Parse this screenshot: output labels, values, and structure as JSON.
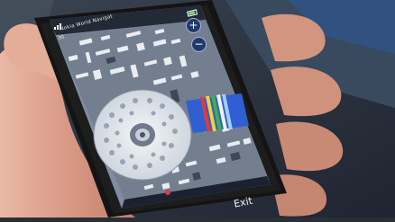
{
  "phone": {
    "app_title": "Nokia World Navigat",
    "network_indicator": "3G",
    "zoom_in_symbol": "+",
    "zoom_out_symbol": "−",
    "softkey_exit_label": "Exit"
  }
}
